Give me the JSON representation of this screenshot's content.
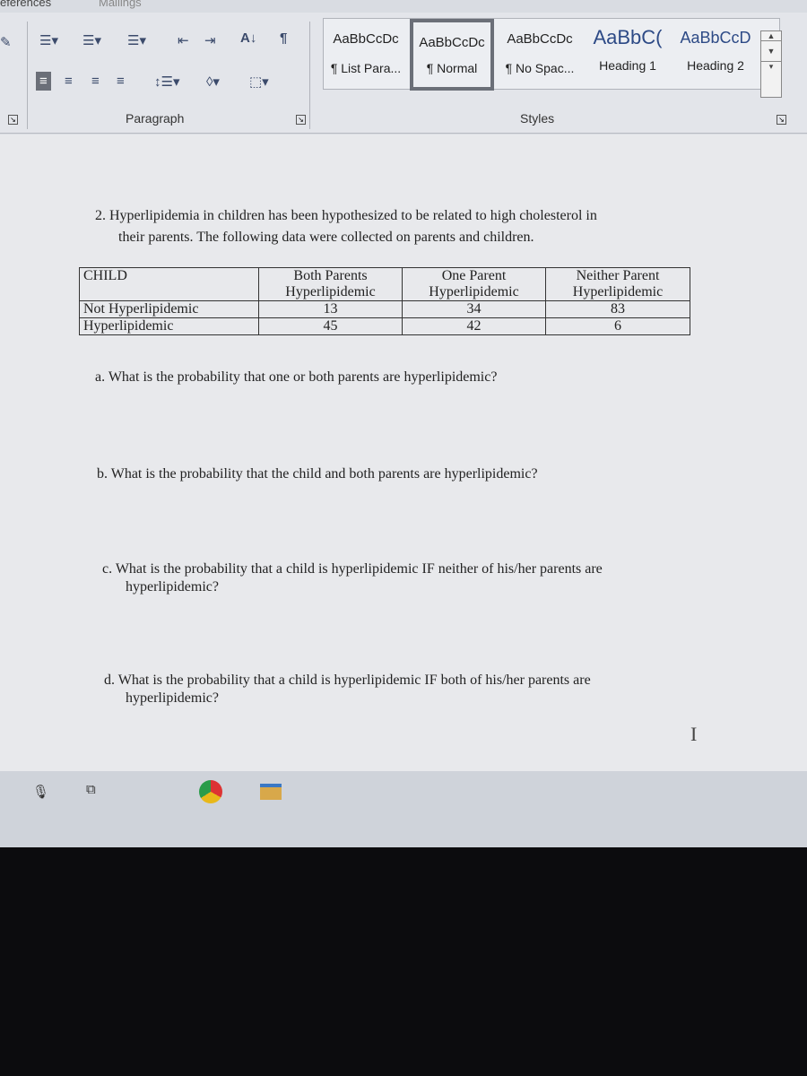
{
  "ribbon_tabs": [
    "eferences",
    "Mailings"
  ],
  "paragraph_group": {
    "label": "Paragraph",
    "icons": [
      "bullets-icon",
      "numbering-icon",
      "multilevel-list-icon",
      "decrease-indent-icon",
      "increase-indent-icon",
      "sort-icon",
      "show-marks-icon",
      "align-left-icon",
      "align-center-icon",
      "align-right-icon",
      "justify-icon",
      "line-spacing-icon",
      "shading-icon",
      "borders-icon"
    ]
  },
  "styles_group": {
    "label": "Styles",
    "items": [
      {
        "preview": "AaBbCcDc",
        "name": "¶ List Para..."
      },
      {
        "preview": "AaBbCcDc",
        "name": "¶ Normal",
        "selected": true
      },
      {
        "preview": "AaBbCcDc",
        "name": "¶ No Spac..."
      },
      {
        "preview": "AaBbC(",
        "name": "Heading 1"
      },
      {
        "preview": "AaBbCcD",
        "name": "Heading 2"
      }
    ]
  },
  "document": {
    "intro_line1": "2.  Hyperlipidemia in children has been hypothesized to be related to high cholesterol in",
    "intro_line2": "their parents.  The following data were collected on parents and children.",
    "table": {
      "header": [
        "CHILD",
        "Both Parents Hyperlipidemic",
        "One Parent Hyperlipidemic",
        "Neither Parent Hyperlipidemic"
      ],
      "header_lines": [
        [
          "CHILD",
          ""
        ],
        [
          "Both Parents",
          "Hyperlipidemic"
        ],
        [
          "One Parent",
          "Hyperlipidemic"
        ],
        [
          "Neither Parent",
          "Hyperlipidemic"
        ]
      ],
      "rows": [
        [
          "Not Hyperlipidemic",
          "13",
          "34",
          "83"
        ],
        [
          "Hyperlipidemic",
          "45",
          "42",
          "6"
        ]
      ]
    },
    "qa": "a.  What is the probability that one or both parents are hyperlipidemic?",
    "qb": "b.  What is the probability that the child and both parents are hyperlipidemic?",
    "qc1": "c.  What is the probability that a child is hyperlipidemic IF neither of his/her parents are",
    "qc2": "hyperlipidemic?",
    "qd1": "d.  What is the probability that a child is hyperlipidemic IF both of his/her parents are",
    "qd2": "hyperlipidemic?"
  },
  "taskbar": {
    "icons": [
      "microphone-icon",
      "task-view-icon",
      "chrome-icon",
      "file-explorer-icon"
    ]
  }
}
